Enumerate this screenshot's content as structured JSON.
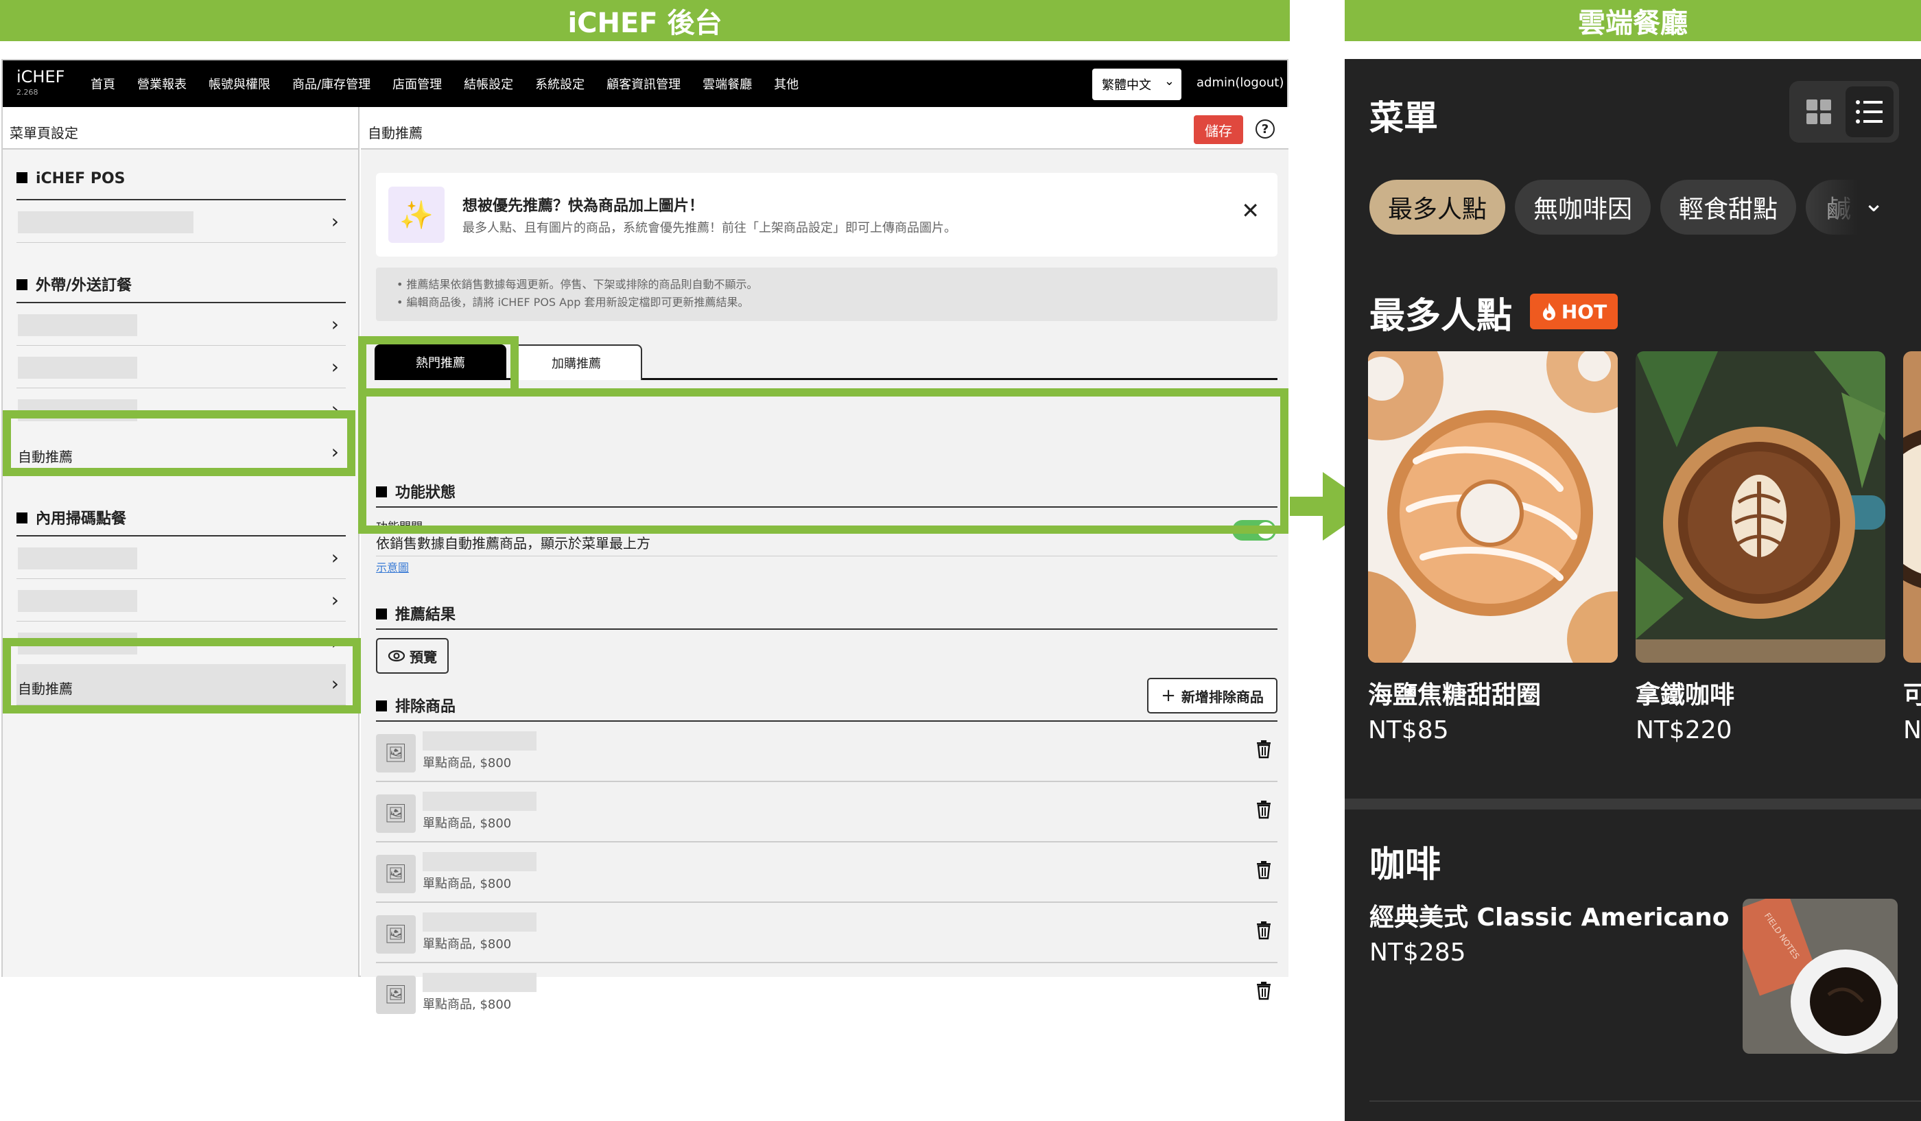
{
  "banners": {
    "admin": "iCHEF 後台",
    "cloud": "雲端餐廳"
  },
  "admin": {
    "logo": "iCHEF",
    "version": "2.268",
    "nav": [
      "首頁",
      "營業報表",
      "帳號與權限",
      "商品/庫存管理",
      "店面管理",
      "結帳設定",
      "系統設定",
      "顧客資訊管理",
      "雲端餐廳",
      "其他"
    ],
    "language": "繁體中文",
    "user": "admin(logout)",
    "sidebar": {
      "title": "菜單頁設定",
      "sections": [
        "iCHEF POS",
        "外帶/外送訂餐",
        "內用掃碼點餐"
      ],
      "auto_item": "自動推薦"
    },
    "main": {
      "title": "自動推薦",
      "save": "儲存",
      "help": "?",
      "tip_title": "想被優先推薦？快為商品加上圖片！",
      "tip_desc": "最多人點、且有圖片的商品，系統會優先推薦！前往「上架商品設定」即可上傳商品圖片。",
      "notes": [
        "推薦結果依銷售數據每週更新。停售、下架或排除的商品則自動不顯示。",
        "編輯商品後，請將 iCHEF POS App 套用新設定檔即可更新推薦結果。"
      ],
      "tabs": [
        "熱門推薦",
        "加購推薦"
      ],
      "status_heading": "功能狀態",
      "toggle_label": "功能開關",
      "toggle_desc": "依銷售數據自動推薦商品，顯示於菜單最上方",
      "example_link": "示意圖",
      "toggle_on": true,
      "result_heading": "推薦結果",
      "preview": "預覽",
      "exclude_heading": "排除商品",
      "add_exclude": "新增排除商品",
      "excluded_items": [
        "單點商品, $800",
        "單點商品, $800",
        "單點商品, $800",
        "單點商品, $800",
        "單點商品, $800"
      ]
    }
  },
  "phone": {
    "title": "菜單",
    "chips": [
      "最多人點",
      "無咖啡因",
      "輕食甜點",
      "鹹"
    ],
    "hot_title": "最多人點",
    "hot_badge": "HOT",
    "products": [
      {
        "name": "海鹽焦糖甜甜圈",
        "price": "NT$85"
      },
      {
        "name": "拿鐵咖啡",
        "price": "NT$220"
      },
      {
        "name": "可",
        "price": "N"
      }
    ],
    "coffee_title": "咖啡",
    "americano": {
      "name": "經典美式 Classic Americano",
      "price": "NT$285",
      "cup_text": "FIELD NOTES"
    }
  },
  "colors": {
    "banner_green": "#86bc40",
    "save_red": "#e0483e",
    "toggle_green": "#5cc05f",
    "chip_active": "#cbb18a",
    "hot_orange": "#ef5a1f",
    "phone_bg": "#232323"
  }
}
